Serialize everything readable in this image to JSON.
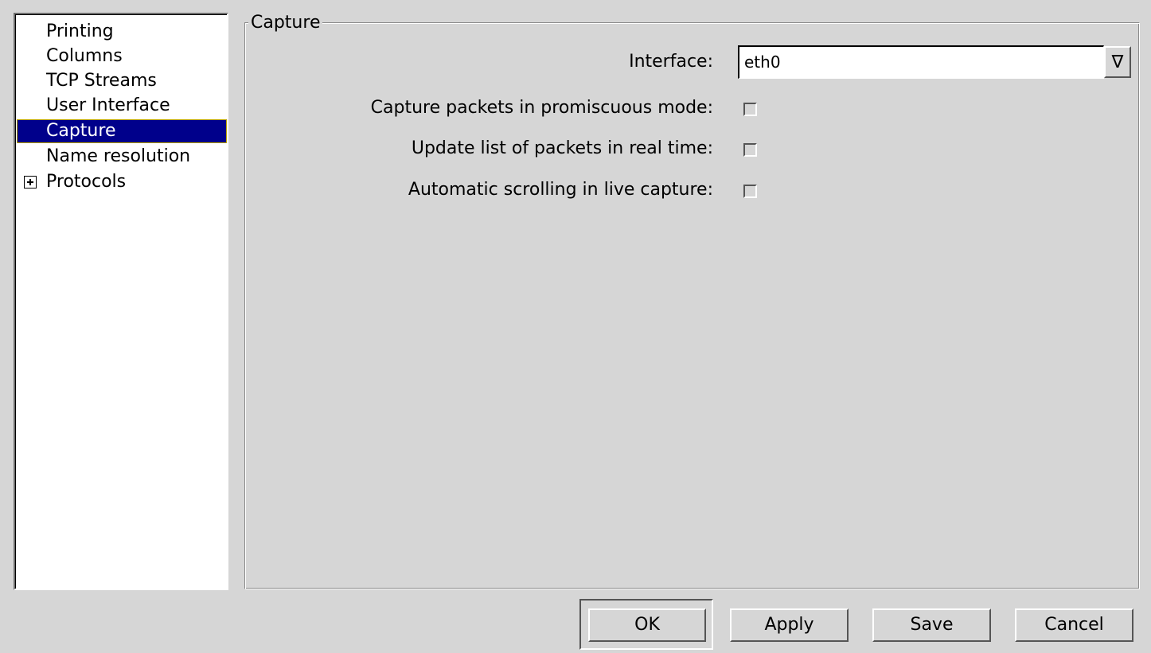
{
  "sidebar": {
    "items": [
      {
        "label": "Printing"
      },
      {
        "label": "Columns"
      },
      {
        "label": "TCP Streams"
      },
      {
        "label": "User Interface"
      },
      {
        "label": "Capture",
        "selected": true
      },
      {
        "label": "Name resolution"
      },
      {
        "label": "Protocols",
        "expander": "plus-icon"
      }
    ]
  },
  "capture": {
    "legend": "Capture",
    "interface_label": "Interface:",
    "interface_value": "eth0",
    "dropdown_icon": "∇",
    "promiscuous_label": "Capture packets in promiscuous mode:",
    "promiscuous_checked": false,
    "realtime_label": "Update list of packets in real time:",
    "realtime_checked": false,
    "autoscroll_label": "Automatic scrolling in live capture:",
    "autoscroll_checked": false
  },
  "buttons": {
    "ok": "OK",
    "apply": "Apply",
    "save": "Save",
    "cancel": "Cancel"
  },
  "colors": {
    "selection": "#00008b",
    "background": "#d6d6d6"
  }
}
